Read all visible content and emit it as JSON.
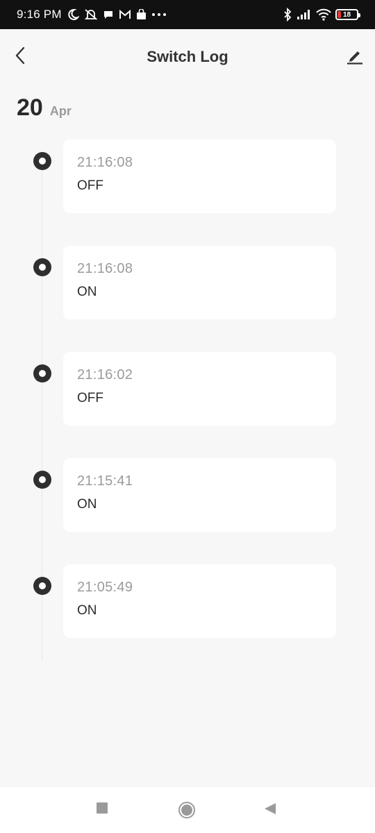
{
  "status_bar": {
    "time": "9:16 PM",
    "battery_level": "18",
    "battery_fraction": 0.18,
    "left_icons": [
      "moon-icon",
      "mute-notifications-icon",
      "chat-bubble-icon",
      "gmail-icon",
      "shopping-bag-icon",
      "more-dots-icon"
    ],
    "right_icons": [
      "bluetooth-icon",
      "signal-icon",
      "wifi-icon",
      "battery-icon"
    ],
    "accent_battery": "#e53935"
  },
  "header": {
    "title": "Switch Log",
    "back_icon": "chevron-left-icon",
    "edit_icon": "pencil-icon"
  },
  "date": {
    "day": "20",
    "month": "Apr"
  },
  "logs": [
    {
      "time": "21:16:08",
      "state": "OFF"
    },
    {
      "time": "21:16:08",
      "state": "ON"
    },
    {
      "time": "21:16:02",
      "state": "OFF"
    },
    {
      "time": "21:15:41",
      "state": "ON"
    },
    {
      "time": "21:05:49",
      "state": "ON"
    }
  ],
  "nav": {
    "buttons": [
      "recents-icon",
      "home-icon",
      "back-icon"
    ]
  },
  "colors": {
    "background": "#f7f7f7",
    "card": "#ffffff",
    "dot": "#2f2f2f",
    "muted_text": "#9a9a9a"
  }
}
